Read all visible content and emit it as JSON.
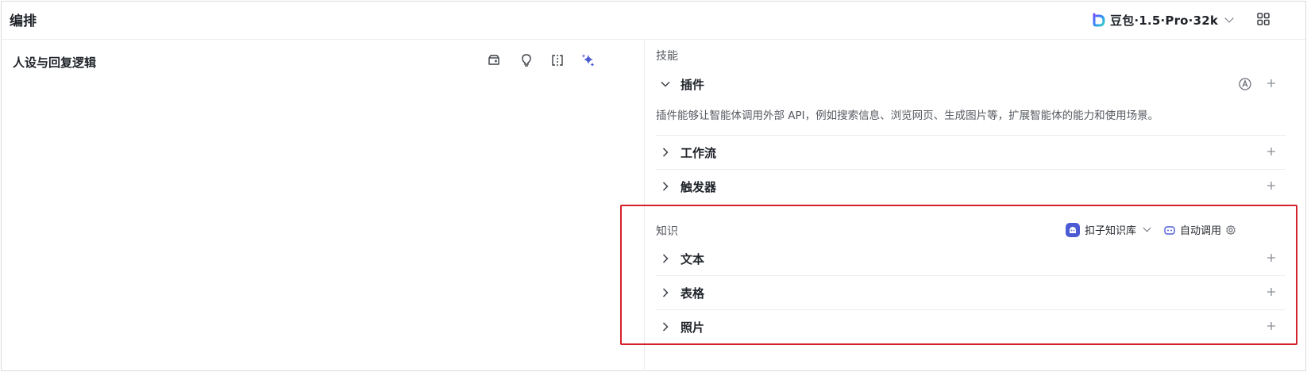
{
  "header": {
    "title": "编排",
    "model_name": "豆包·1.5·Pro·32k"
  },
  "left": {
    "title": "人设与回复逻辑",
    "tools": [
      "prompt-library-icon",
      "lightbulb-icon",
      "split-view-icon",
      "sparkle-icon"
    ]
  },
  "skills": {
    "label": "技能",
    "plugins": {
      "label": "插件",
      "description": "插件能够让智能体调用外部 API，例如搜索信息、浏览网页、生成图片等，扩展智能体的能力和使用场景。"
    },
    "workflow": {
      "label": "工作流"
    },
    "trigger": {
      "label": "触发器"
    }
  },
  "knowledge": {
    "label": "知识",
    "kb_selector": "扣子知识库",
    "auto_call": "自动调用",
    "items": [
      {
        "label": "文本"
      },
      {
        "label": "表格"
      },
      {
        "label": "照片"
      }
    ]
  },
  "colors": {
    "accent": "#4c5bd4",
    "highlight_border": "#d32029"
  }
}
